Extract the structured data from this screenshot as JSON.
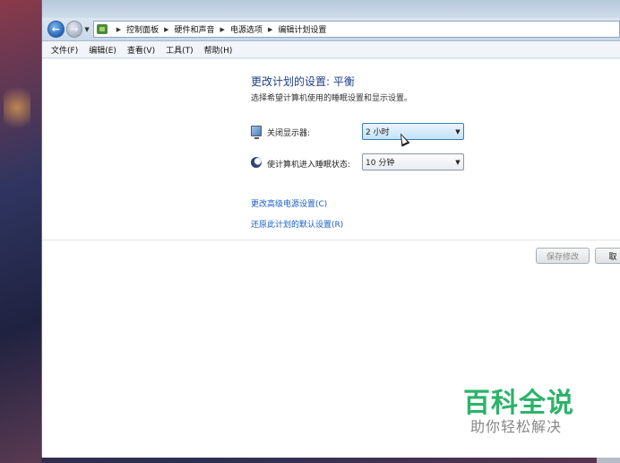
{
  "address": {
    "crumbs": [
      "控制面板",
      "硬件和声音",
      "电源选项",
      "编辑计划设置"
    ]
  },
  "menu": [
    "文件(F)",
    "编辑(E)",
    "查看(V)",
    "工具(T)",
    "帮助(H)"
  ],
  "plan": {
    "title": "更改计划的设置: 平衡",
    "description": "选择希望计算机使用的睡眠设置和显示设置。"
  },
  "settings": {
    "display_label": "关闭显示器:",
    "display_value": "2 小时",
    "sleep_label": "使计算机进入睡眠状态:",
    "sleep_value": "10 分钟"
  },
  "links": {
    "advanced": "更改高级电源设置(C)",
    "restore": "还原此计划的默认设置(R)"
  },
  "buttons": {
    "save": "保存修改",
    "cancel": "取"
  },
  "watermark": {
    "brand": "百科全说",
    "slogan": "助你轻松解决"
  },
  "colors": {
    "title_blue": "#1e3e8a",
    "link_blue": "#1a5ec9",
    "watermark_green": "#2db36a"
  }
}
